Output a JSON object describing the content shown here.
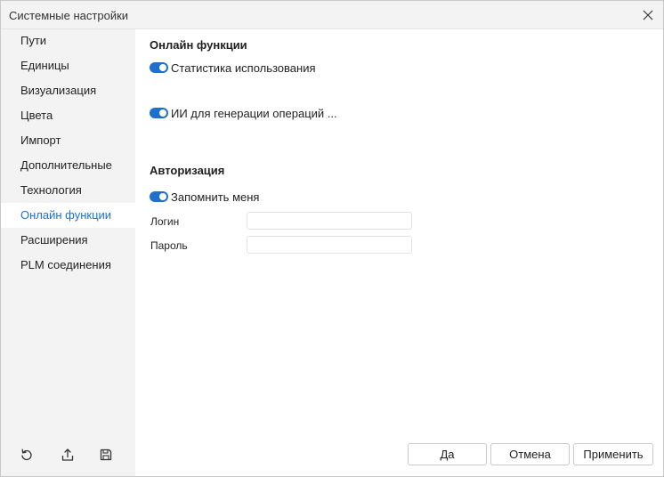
{
  "window": {
    "title": "Системные настройки"
  },
  "icons": {
    "close": "close-icon",
    "reset": "reset-icon",
    "export": "export-icon",
    "save": "save-icon"
  },
  "colors": {
    "accent": "#1f6fd1",
    "sidebar_bg": "#f3f3f3"
  },
  "sidebar": {
    "items": [
      {
        "label": "Пути",
        "active": false
      },
      {
        "label": "Единицы",
        "active": false
      },
      {
        "label": "Визуализация",
        "active": false
      },
      {
        "label": "Цвета",
        "active": false
      },
      {
        "label": "Импорт",
        "active": false
      },
      {
        "label": "Дополнительные",
        "active": false
      },
      {
        "label": "Технология",
        "active": false
      },
      {
        "label": "Онлайн функции",
        "active": true
      },
      {
        "label": "Расширения",
        "active": false
      },
      {
        "label": "PLM соединения",
        "active": false
      }
    ]
  },
  "main": {
    "online_section": {
      "title": "Онлайн функции",
      "usage_stats": {
        "label": "Статистика использования",
        "enabled": true
      },
      "ai_operations": {
        "label": "ИИ для генерации операций ...",
        "enabled": true
      }
    },
    "auth_section": {
      "title": "Авторизация",
      "remember_me": {
        "label": "Запомнить меня",
        "enabled": true
      },
      "login": {
        "label": "Логин",
        "value": ""
      },
      "password": {
        "label": "Пароль",
        "value": ""
      }
    }
  },
  "footer": {
    "ok_label": "Да",
    "cancel_label": "Отмена",
    "apply_label": "Применить"
  }
}
